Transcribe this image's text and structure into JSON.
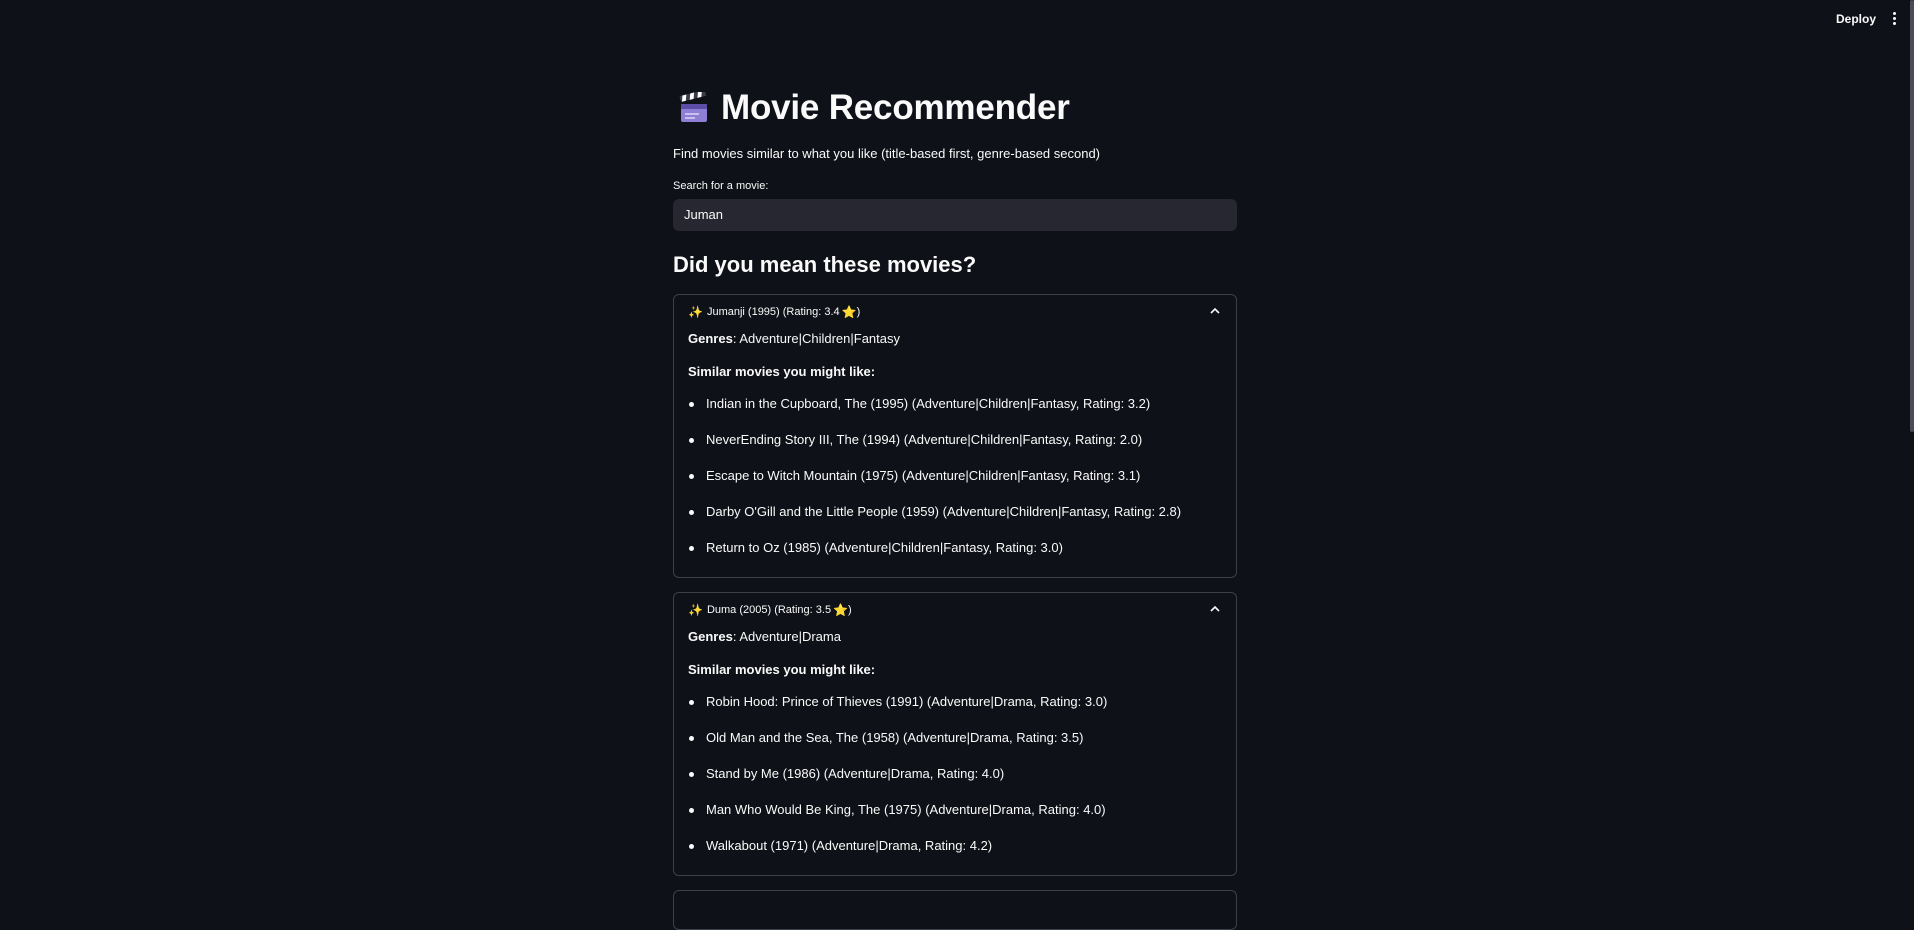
{
  "header": {
    "deploy_label": "Deploy"
  },
  "app": {
    "title": "Movie Recommender",
    "subtitle": "Find movies similar to what you like (title-based first, genre-based second)",
    "search_label": "Search for a movie:",
    "search_value": "Juman",
    "results_heading": "Did you mean these movies?"
  },
  "results": [
    {
      "header": "Jumanji (1995) (Rating: 3.4",
      "genres_label": "Genres",
      "genres": ": Adventure|Children|Fantasy",
      "similar_heading": "Similar movies you might like:",
      "similar": [
        "Indian in the Cupboard, The (1995) (Adventure|Children|Fantasy, Rating: 3.2)",
        "NeverEnding Story III, The (1994) (Adventure|Children|Fantasy, Rating: 2.0)",
        "Escape to Witch Mountain (1975) (Adventure|Children|Fantasy, Rating: 3.1)",
        "Darby O'Gill and the Little People (1959) (Adventure|Children|Fantasy, Rating: 2.8)",
        "Return to Oz (1985) (Adventure|Children|Fantasy, Rating: 3.0)"
      ]
    },
    {
      "header": "Duma (2005) (Rating: 3.5",
      "genres_label": "Genres",
      "genres": ": Adventure|Drama",
      "similar_heading": "Similar movies you might like:",
      "similar": [
        "Robin Hood: Prince of Thieves (1991) (Adventure|Drama, Rating: 3.0)",
        "Old Man and the Sea, The (1958) (Adventure|Drama, Rating: 3.5)",
        "Stand by Me (1986) (Adventure|Drama, Rating: 4.0)",
        "Man Who Would Be King, The (1975) (Adventure|Drama, Rating: 4.0)",
        "Walkabout (1971) (Adventure|Drama, Rating: 4.2)"
      ]
    }
  ],
  "icons": {
    "title_icon": "clapper-board-icon",
    "expander_prefix": "sparkles-icon",
    "rating_suffix": "star-icon",
    "expander_toggle": "chevron-up-icon",
    "menu": "kebab-menu-icon"
  },
  "colors": {
    "background": "#0e1117",
    "input_background": "#262730",
    "border": "#3d404a",
    "accent_star": "#f7c843"
  }
}
